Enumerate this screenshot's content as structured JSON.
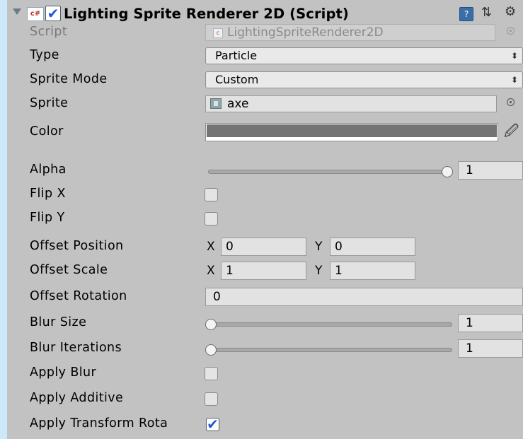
{
  "component": {
    "title": "Lighting Sprite Renderer 2D (Script)",
    "enabled": true,
    "icons": {
      "foldout": "foldout-arrow-icon",
      "script": "csharp-script-icon",
      "help": "help-book-icon",
      "preset": "preset-icon",
      "settings": "gear-icon"
    },
    "icon_text": {
      "script": "c#",
      "help": "?",
      "preset": "⇅",
      "settings": "⚙"
    }
  },
  "fields": {
    "script": {
      "label": "Script",
      "value": "LightingSpriteRenderer2D",
      "mini_icon": "c"
    },
    "type": {
      "label": "Type",
      "value": "Particle",
      "arrows": "⬍"
    },
    "sprite_mode": {
      "label": "Sprite Mode",
      "value": "Custom",
      "arrows": "⬍"
    },
    "sprite": {
      "label": "Sprite",
      "value": "axe"
    },
    "color": {
      "label": "Color",
      "swatch": "#747474",
      "alpha_bar": "#ffffff",
      "eyedropper": "🖉"
    },
    "alpha": {
      "label": "Alpha",
      "value": "1",
      "slider_fraction": 1.0
    },
    "flip_x": {
      "label": "Flip X",
      "checked": false
    },
    "flip_y": {
      "label": "Flip Y",
      "checked": false
    },
    "offset_position": {
      "label": "Offset Position",
      "x_label": "X",
      "x": "0",
      "y_label": "Y",
      "y": "0"
    },
    "offset_scale": {
      "label": "Offset Scale",
      "x_label": "X",
      "x": "1",
      "y_label": "Y",
      "y": "1"
    },
    "offset_rotation": {
      "label": "Offset Rotation",
      "value": "0"
    },
    "blur_size": {
      "label": "Blur Size",
      "value": "1",
      "slider_fraction": 0.0
    },
    "blur_iterations": {
      "label": "Blur Iterations",
      "value": "1",
      "slider_fraction": 0.0
    },
    "apply_blur": {
      "label": "Apply Blur",
      "checked": false
    },
    "apply_additive": {
      "label": "Apply Additive",
      "checked": false
    },
    "apply_transform_rotation": {
      "label": "Apply Transform Rota",
      "checked": true,
      "check_glyph": "✔"
    }
  },
  "colors": {
    "panel_bg": "#c2c2c2",
    "outer_bg": "#cde8f8",
    "check_blue": "#1e5bd6"
  }
}
